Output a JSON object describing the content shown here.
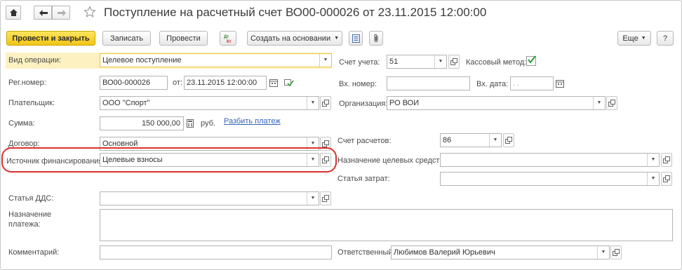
{
  "header": {
    "title": "Поступление на расчетный счет ВО00-000026 от 23.11.2015 12:00:00"
  },
  "toolbar": {
    "post_close": "Провести и закрыть",
    "save": "Записать",
    "post": "Провести",
    "create_based": "Создать на основании",
    "more": "Еще",
    "help": "?"
  },
  "form": {
    "vid_operatsii": {
      "label": "Вид операции:",
      "value": "Целевое поступление"
    },
    "reg_nomer": {
      "label": "Рег.номер:",
      "value": "ВО00-000026",
      "ot_label": "от:",
      "date": "23.11.2015 12:00:00"
    },
    "platelshchik": {
      "label": "Плательщик:",
      "value": "ООО \"Спорт\""
    },
    "summa": {
      "label": "Сумма:",
      "value": "150 000,00",
      "currency": "руб.",
      "split_link": "Разбить платеж"
    },
    "dogovor": {
      "label": "Договор:",
      "value": "Основной"
    },
    "istochnik": {
      "label": "Источник финансирования:",
      "value": "Целевые взносы"
    },
    "statya_dds": {
      "label": "Статья ДДС:",
      "value": ""
    },
    "naznachenie_platezha": {
      "label_line1": "Назначение",
      "label_line2": "платежа:",
      "value": ""
    },
    "kommentariy": {
      "label": "Комментарий:",
      "value": ""
    },
    "schet_ucheta": {
      "label": "Счет учета:",
      "value": "51"
    },
    "kassovy_metod": {
      "label": "Кассовый метод:",
      "checked": true
    },
    "vh_nomer": {
      "label": "Вх. номер:",
      "value": ""
    },
    "vh_data": {
      "label": "Вх. дата:",
      "value": " .  ."
    },
    "organizatsiya": {
      "label": "Организация:",
      "value": "РО ВОИ"
    },
    "schet_raschetov": {
      "label": "Счет расчетов:",
      "value": "86"
    },
    "naznachenie_tselevyh": {
      "label": "Назначение целевых средств:",
      "value": ""
    },
    "statya_zatrat": {
      "label": "Статья затрат:",
      "value": ""
    },
    "otvetstvenny": {
      "label": "Ответственный:",
      "value": "Любимов Валерий Юрьевич"
    }
  },
  "colors": {
    "primary_button": "#f2c516",
    "highlight_oval": "#d9312e",
    "link": "#3263b8",
    "active_field_border": "#f0c232"
  }
}
